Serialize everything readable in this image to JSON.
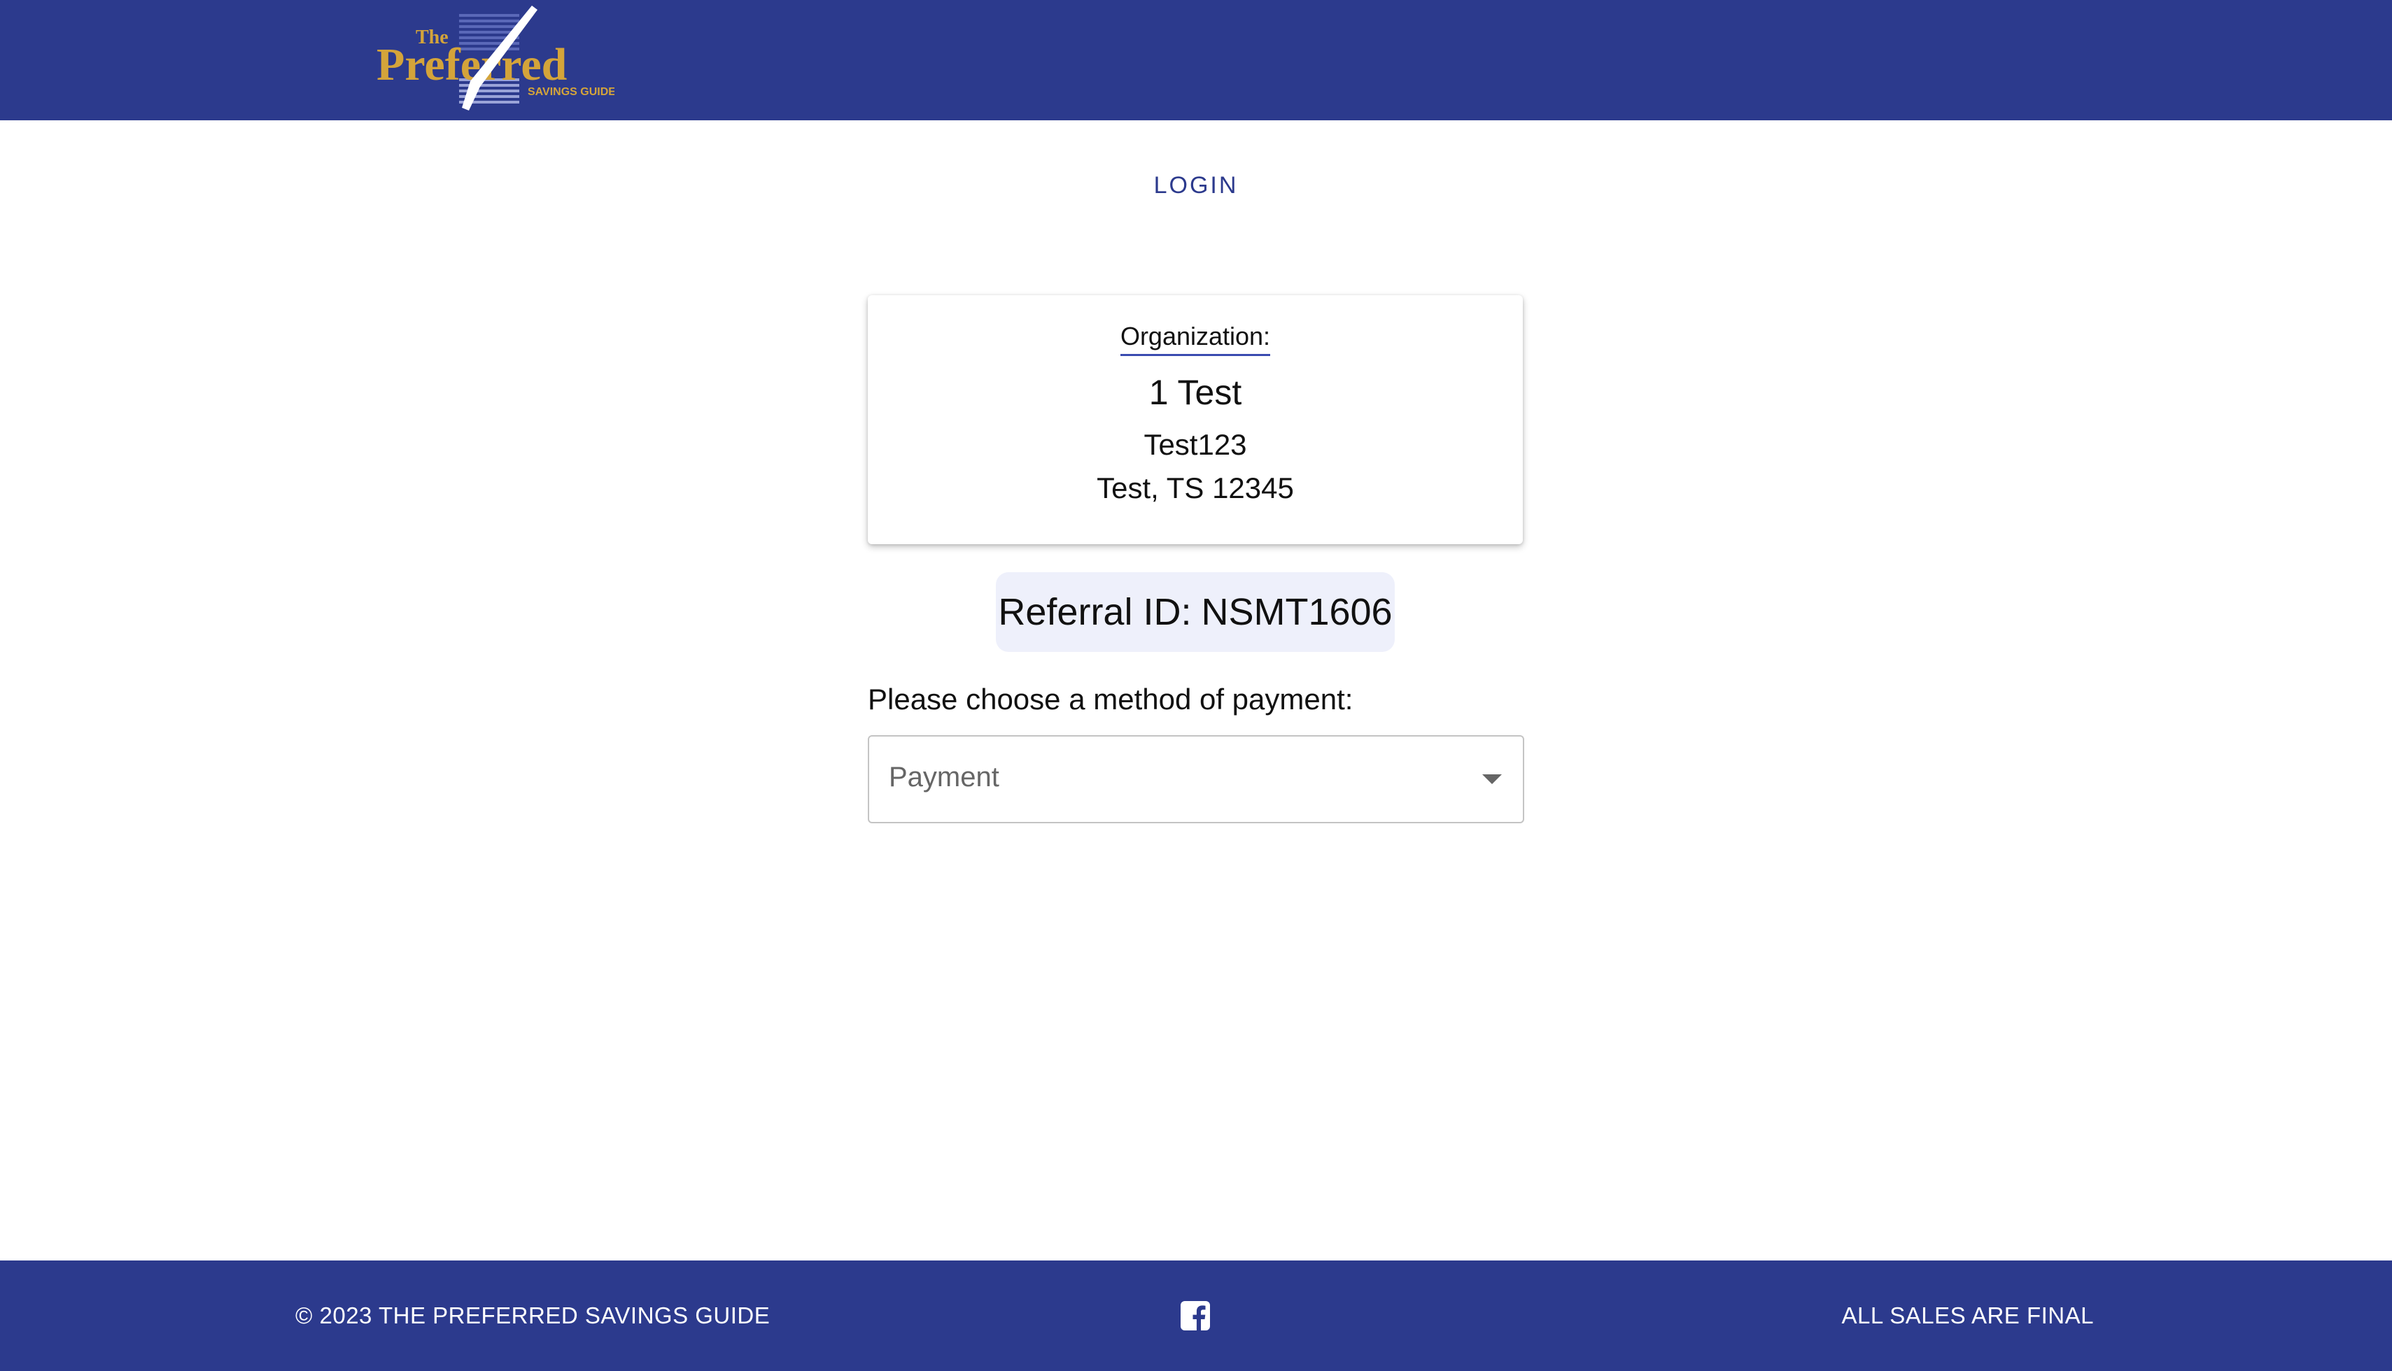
{
  "header": {
    "logo": {
      "line_small": "The",
      "line_big": "Preferred",
      "line_sub": "SAVINGS GUIDE",
      "icon": "checkmark-logo"
    }
  },
  "nav": {
    "login_label": "LOGIN"
  },
  "organization": {
    "label": "Organization:",
    "name": "1 Test",
    "address_line1": "Test123",
    "address_line2": "Test, TS 12345"
  },
  "referral": {
    "label": "Referral ID:",
    "id": "NSMT1606"
  },
  "payment": {
    "prompt": "Please choose a method of payment:",
    "select_placeholder": "Payment",
    "selected_value": ""
  },
  "footer": {
    "copyright": "© 2023 THE PREFERRED SAVINGS GUIDE",
    "notice": "ALL SALES ARE FINAL",
    "social_icon": "facebook-icon"
  },
  "colors": {
    "brand_blue": "#2c3a8d",
    "logo_gold": "#d4a43a",
    "chip_bg": "#eef0fb"
  }
}
